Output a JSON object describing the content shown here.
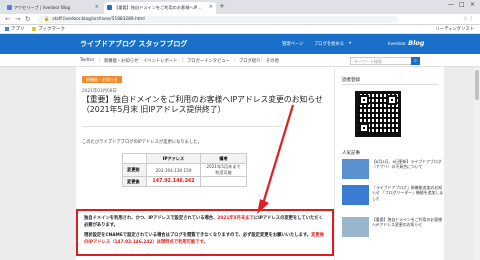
{
  "browser": {
    "tabs": [
      {
        "label": "アクセリーブ | livedoor Blog"
      },
      {
        "label": "【重要】独自ドメインをご利用のお客様へIP…"
      }
    ],
    "new_tab": "+",
    "url": "staff.livedoor.blog/archives/51983289.html",
    "bookmarks": [
      "アプリ",
      "ブックマーク"
    ],
    "reading_list": "リーディングリスト"
  },
  "site": {
    "title": "ライブドアブログ スタッフブログ",
    "nav": [
      "管理ページ",
      "ブログを始める"
    ],
    "logo_prefix": "livedoor",
    "logo": "Blog"
  },
  "subnav": {
    "items": [
      "Twitter",
      "新機能・お知らせ",
      "イベントレポート",
      "ブロガーインタビュー",
      "ブログ紹介",
      "その他"
    ],
    "search_placeholder": "キーワード検索"
  },
  "article": {
    "category": "新機能・お知らせ",
    "date": "2021年03月08日",
    "title": "【重要】独自ドメインをご利用のお客様へIPアドレス変更のお知らせ（2021年5月末 旧IPアドレス提供終了）",
    "intro": "このたびライブドアブログのIPアドレスが変更になりました。",
    "table": {
      "headers": [
        "IPアドレス",
        "備考"
      ],
      "rows": [
        {
          "label": "変更前",
          "ip": "203.104.130.159",
          "note": "2021年5月末まで利用可能"
        },
        {
          "label": "変更後",
          "ip": "147.92.146.242",
          "note": ""
        }
      ]
    },
    "notice": {
      "line1_a": "独自ドメインを利用され、かつ、IPアドレスで設定されている場合、",
      "line1_b": "2021年5月末まで",
      "line1_c": "にIPアドレスの変更をしていただく必要があります。",
      "line2_a": "現状設定をCNAMEで設定されている場合はブログを閲覧できなくなりますので、必ず設定変更をお願いいたします。",
      "line2_b": "変更後のIPアドレス（147.92.146.242）は現時点で利用可能です。"
    }
  },
  "sidebar": {
    "heading": "読者登録",
    "popular_heading": "人気記事",
    "items": [
      {
        "text": "【8月4日、6日更新】ライブドアブログ（アプリ）の不具合について"
      },
      {
        "text": "「ライブドアブログ」新機能追加のお知らせ 「ブログリーダー」機能を追加しました"
      },
      {
        "text": "【重要】独自ドメインをご利用のお客様へIPアドレス変更のお知らせ"
      }
    ]
  },
  "colors": {
    "header_blue": "#1a6fc9",
    "category_orange": "#f08a2e",
    "alert_red": "#d42020"
  }
}
